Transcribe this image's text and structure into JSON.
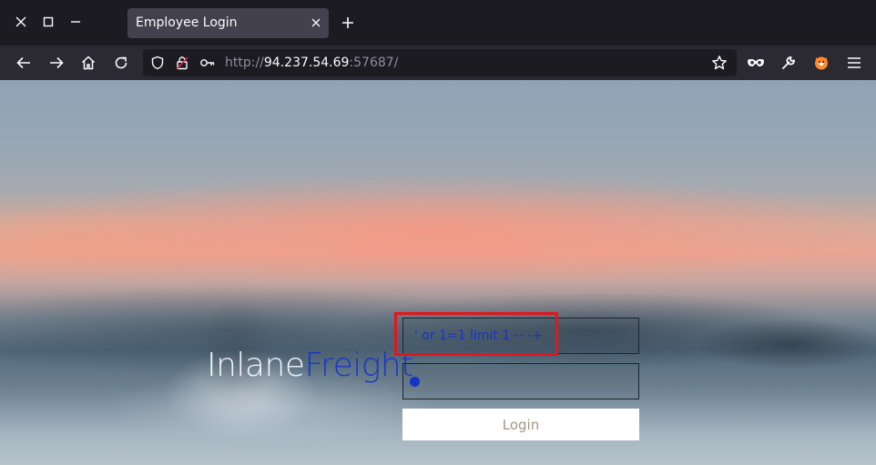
{
  "window": {
    "controls": [
      "close-icon",
      "maximize-icon",
      "minimize-icon"
    ]
  },
  "tab": {
    "title": "Employee Login"
  },
  "nav": {
    "url_scheme": "http://",
    "url_host": "94.237.54.69",
    "url_port": ":57687/"
  },
  "brand": {
    "part1": "Inlane",
    "part2": "Freight"
  },
  "form": {
    "username_value": "' or 1=1 limit 1 -- -+",
    "login_label": "Login"
  },
  "colors": {
    "accent": "#1733c8",
    "highlight": "#e2161b"
  }
}
